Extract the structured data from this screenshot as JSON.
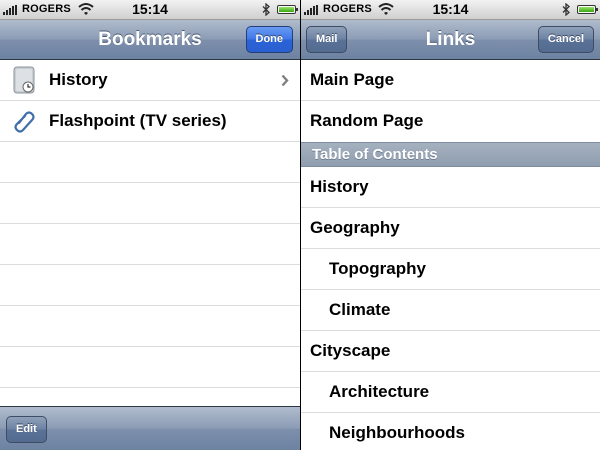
{
  "left": {
    "status_bar": {
      "carrier": "ROGERS",
      "time": "15:14"
    },
    "nav": {
      "title": "Bookmarks",
      "done_label": "Done"
    },
    "bookmarks": [
      {
        "label": "History",
        "icon": "folder-icon"
      },
      {
        "label": "Flashpoint (TV series)",
        "icon": "paperclip-icon"
      }
    ],
    "toolbar": {
      "edit_label": "Edit"
    }
  },
  "right": {
    "status_bar": {
      "carrier": "ROGERS",
      "time": "15:14"
    },
    "nav": {
      "title": "Links",
      "mail_label": "Mail",
      "cancel_label": "Cancel"
    },
    "top_links": [
      "Main Page",
      "Random Page"
    ],
    "section_header": "Table of Contents",
    "toc": [
      {
        "label": "History",
        "level": 1
      },
      {
        "label": "Geography",
        "level": 1
      },
      {
        "label": "Topography",
        "level": 2
      },
      {
        "label": "Climate",
        "level": 2
      },
      {
        "label": "Cityscape",
        "level": 1
      },
      {
        "label": "Architecture",
        "level": 2
      },
      {
        "label": "Neighbourhoods",
        "level": 2
      }
    ]
  },
  "colors": {
    "nav_bar": "#8a9bb4",
    "done_button": "#3d76e6",
    "section_header": "#9aa7b7",
    "battery": "#5bc722"
  }
}
